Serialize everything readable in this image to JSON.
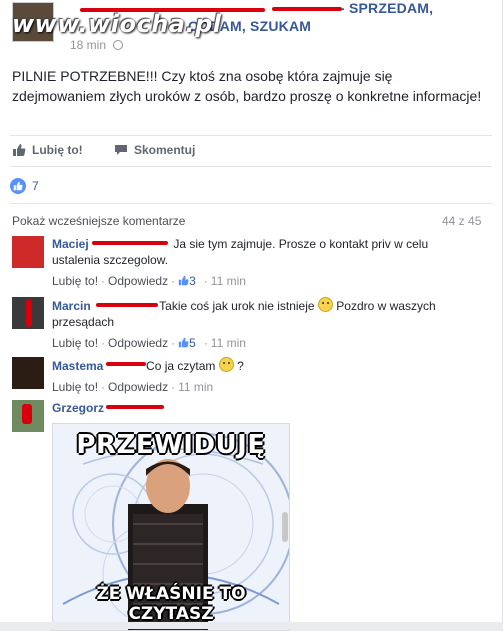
{
  "header": {
    "group_name_line1": "- SPRZEDAM,",
    "group_name_line2": "ODDAM, SZUKAM",
    "watermark": "www.wiocha.pl",
    "time": "18 min"
  },
  "post": {
    "text": "PILNIE POTRZEBNE!!! Czy ktoś zna osobę która zajmuje się zdejmowaniem złych uroków z osób, bardzo proszę o konkretne informacje!"
  },
  "actions": {
    "like_label": "Lubię to!",
    "comment_label": "Skomentuj"
  },
  "likes": {
    "count": "7"
  },
  "comments_section": {
    "view_previous": "Pokaż wcześniejsze komentarze",
    "count": "44 z 45"
  },
  "comments": [
    {
      "name": "Maciej",
      "text": "Ja sie tym zajmuje. Prosze o kontakt priv w celu ustalenia szczegolow.",
      "like": "Lubię to!",
      "reply": "Odpowiedz",
      "likes": "3",
      "time": "11 min"
    },
    {
      "name": "Marcin",
      "text": "Takie coś jak urok nie istnieje",
      "text_after": "Pozdro w waszych przesądach",
      "like": "Lubię to!",
      "reply": "Odpowiedz",
      "likes": "5",
      "time": "11 min"
    },
    {
      "name": "Mastema",
      "text": "Co ja czytam",
      "text_after": "?",
      "like": "Lubię to!",
      "reply": "Odpowiedz",
      "time": "11 min"
    },
    {
      "name": "Grzegorz"
    }
  ],
  "meme": {
    "top_text": "PRZEWIDUJĘ",
    "bottom_text": "ŻE WŁAŚNIE TO CZYTASZ"
  },
  "colors": {
    "link_blue": "#365899",
    "like_badge": "#5890ff",
    "redaction_red": "#d8000c"
  }
}
